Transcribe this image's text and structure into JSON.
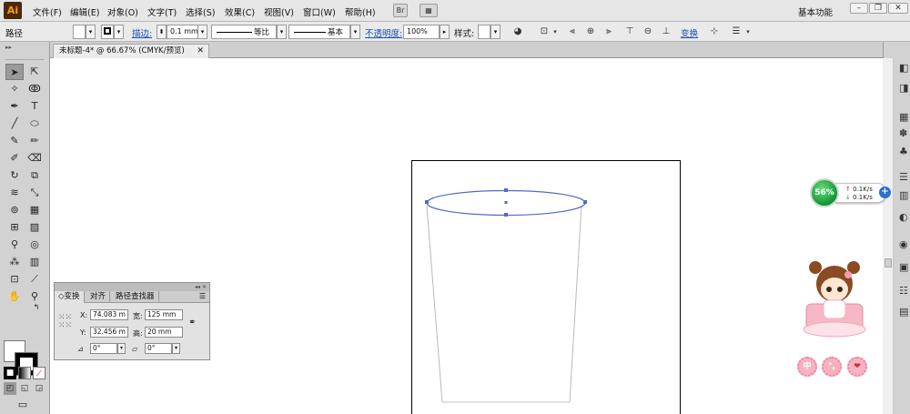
{
  "app": {
    "logo": "Ai",
    "workspace": "基本功能"
  },
  "menu": [
    "文件(F)",
    "编辑(E)",
    "对象(O)",
    "文字(T)",
    "选择(S)",
    "效果(C)",
    "视图(V)",
    "窗口(W)",
    "帮助(H)"
  ],
  "menu_extras": {
    "bridge": "Br",
    "arrange": "▦"
  },
  "control": {
    "selection_type": "路径",
    "stroke_label": "描边:",
    "stroke_weight": "0.1 mm",
    "profile": "等比",
    "brush": "基本",
    "opacity_label": "不透明度:",
    "opacity": "100%",
    "style_label": "样式:",
    "transform_label": "变换"
  },
  "document": {
    "tab_title": "未标题-4* @ 66.67% (CMYK/预览)"
  },
  "transform_panel": {
    "tabs": [
      "变换",
      "对齐",
      "路径查找器"
    ],
    "x_label": "X:",
    "x": "74.083 m",
    "y_label": "Y:",
    "y": "32.456 m",
    "w_label": "宽:",
    "w": "125 mm",
    "h_label": "高:",
    "h": "20 mm",
    "rotate": "0°",
    "shear": "0°"
  },
  "speed_widget": {
    "percent": "56%",
    "up": "0.1K/s",
    "down": "0.1K/s"
  },
  "decoration": {
    "badges": [
      "中",
      "°,",
      "❤"
    ]
  },
  "colors": {
    "path_blue": "#4f6cc7",
    "accent_link": "#1a4fb5"
  }
}
